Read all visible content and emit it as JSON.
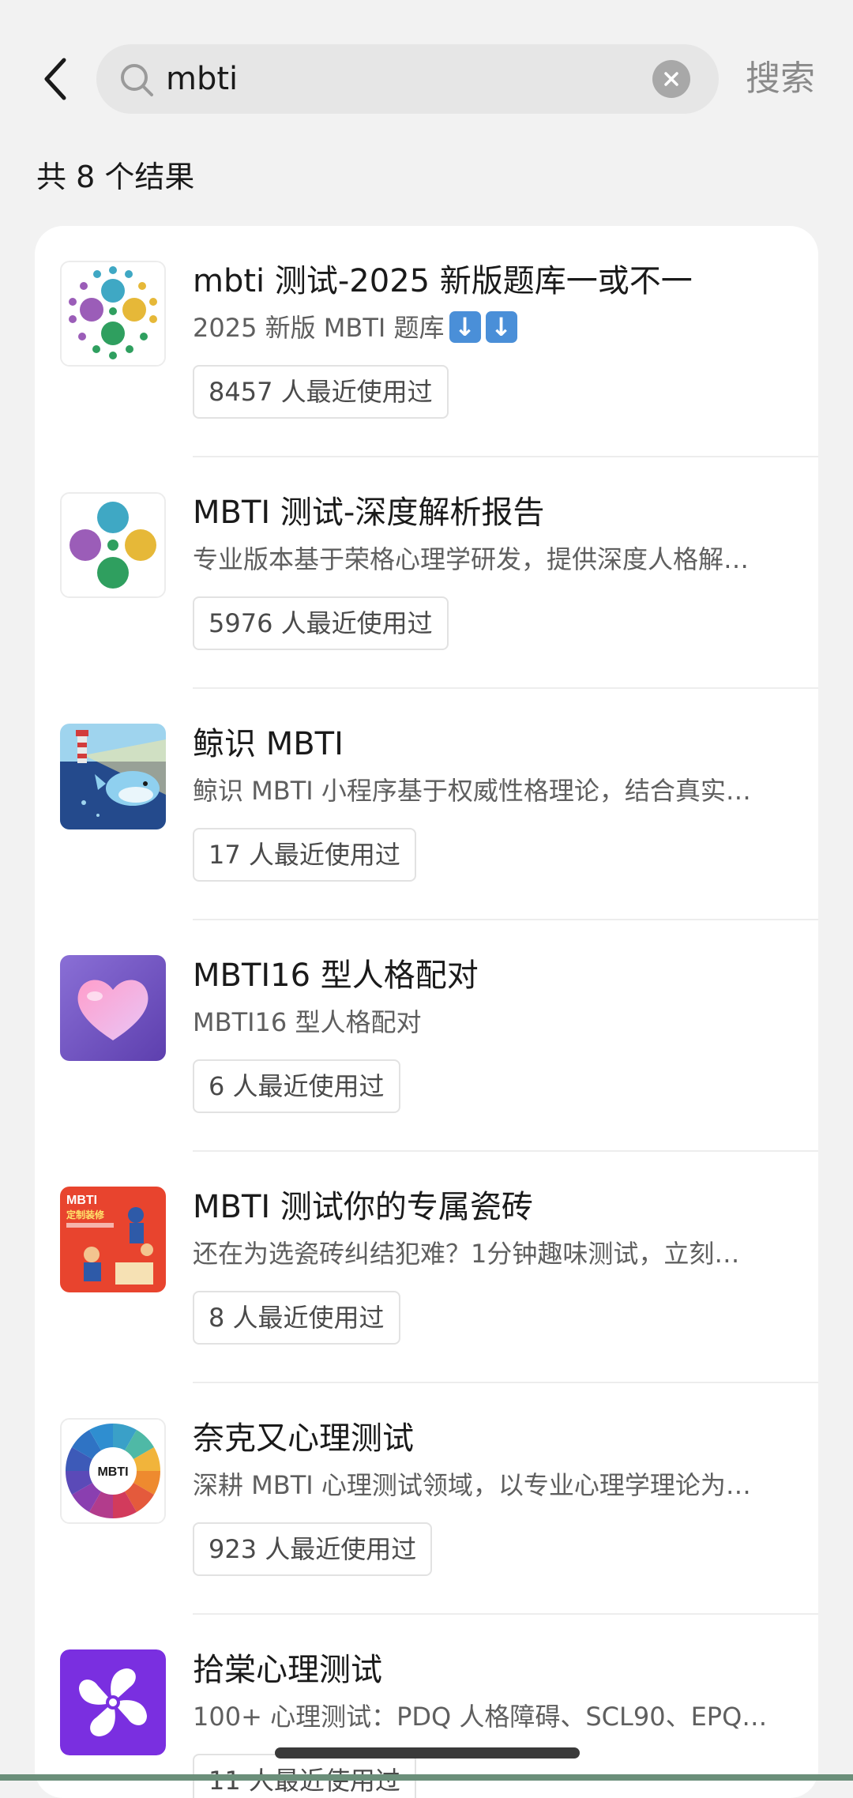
{
  "header": {
    "query": "mbti",
    "search_label": "搜索"
  },
  "result_count": "共 8 个结果",
  "results": [
    {
      "title": "mbti 测试-2025 新版题库一或不一",
      "desc": "2025 新版 MBTI 题库",
      "users": "8457 人最近使用过",
      "icon": "colorful-dots-icon"
    },
    {
      "title": "MBTI 测试-深度解析报告",
      "desc": "专业版本基于荣格心理学研发，提供深度人格解…",
      "users": "5976 人最近使用过",
      "icon": "four-circles-icon"
    },
    {
      "title": "鲸识 MBTI",
      "desc": "鲸识 MBTI 小程序基于权威性格理论，结合真实…",
      "users": "17 人最近使用过",
      "icon": "whale-lighthouse-icon"
    },
    {
      "title": "MBTI16 型人格配对",
      "desc": "MBTI16 型人格配对",
      "users": "6 人最近使用过",
      "icon": "heart-icon"
    },
    {
      "title": "MBTI 测试你的专属瓷砖",
      "desc": "还在为选瓷砖纠结犯难？1分钟趣味测试，立刻…",
      "users": "8 人最近使用过",
      "icon": "tile-poster-icon"
    },
    {
      "title": "奈克又心理测试",
      "desc": "深耕 MBTI 心理测试领域，以专业心理学理论为…",
      "users": "923 人最近使用过",
      "icon": "mbti-wheel-icon"
    },
    {
      "title": "拾棠心理测试",
      "desc": "100+ 心理测试：PDQ 人格障碍、SCL90、EPQ…",
      "users": "11 人最近使用过",
      "icon": "pinwheel-icon"
    }
  ],
  "wheel_center": "MBTI",
  "tile_poster": {
    "line1": "MBTI",
    "line2": "定制装修"
  },
  "colors": {
    "background": "#f2f2f2",
    "card": "#ffffff",
    "accent_purple": "#7a2fe0"
  }
}
